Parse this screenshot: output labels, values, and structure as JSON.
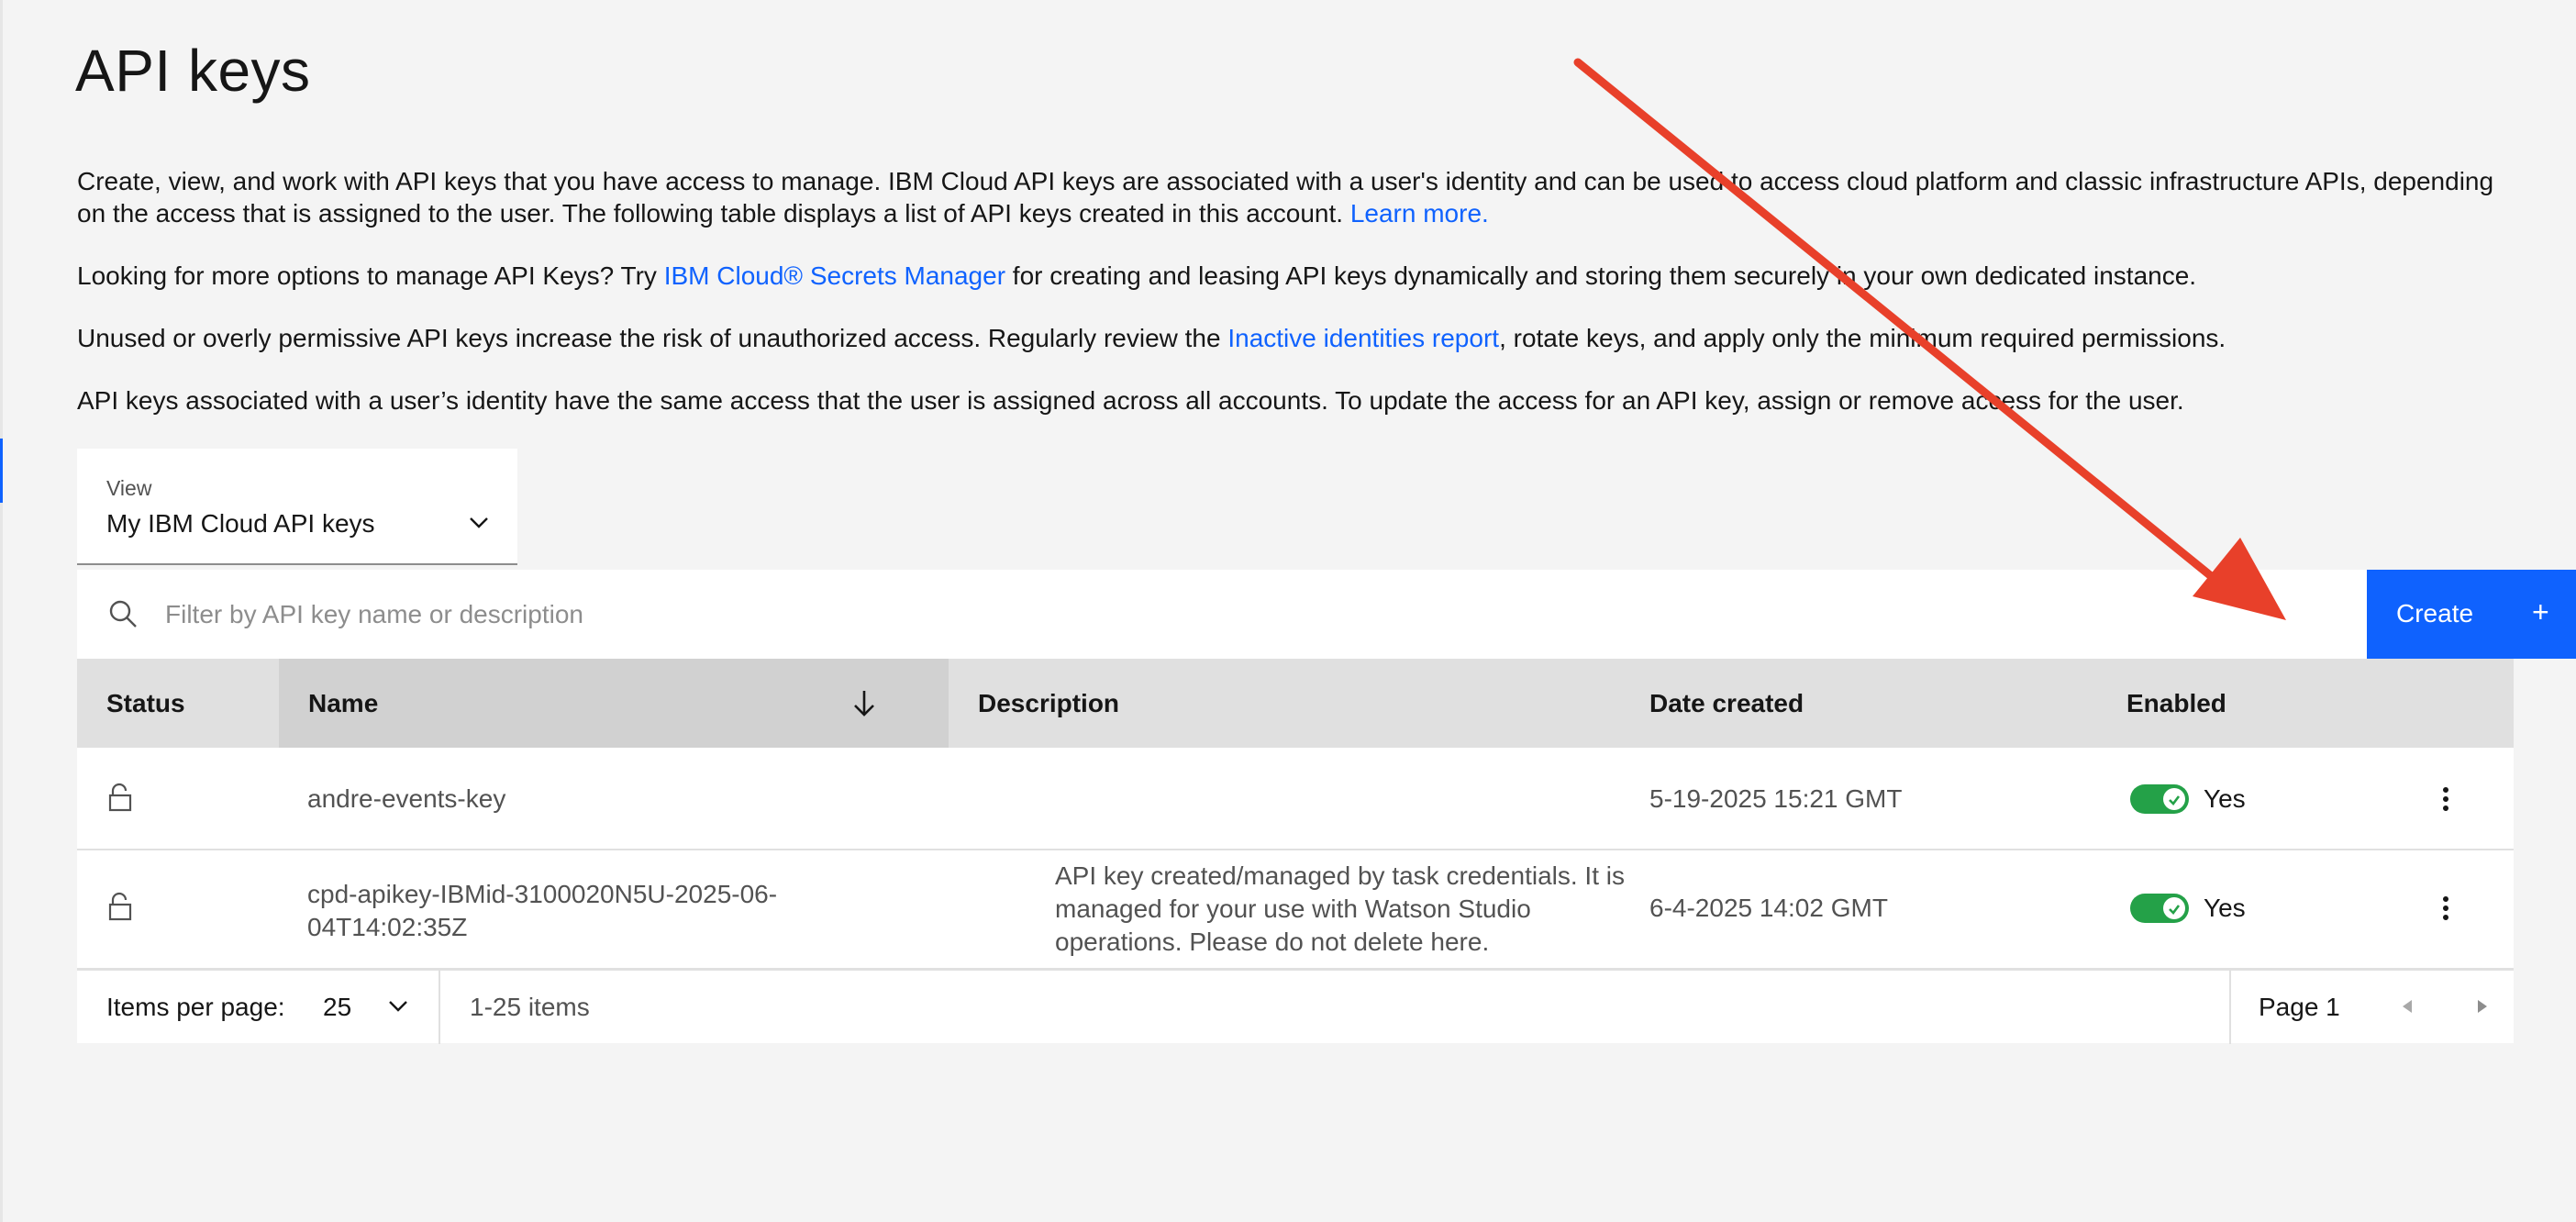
{
  "page": {
    "title": "API keys"
  },
  "intro": {
    "p1_text": "Create, view, and work with API keys that you have access to manage. IBM Cloud API keys are associated with a user's identity and can be used to access cloud platform and classic infrastructure APIs, depending on the access that is assigned to the user. The following table displays a list of API keys created in this account. ",
    "p1_link": "Learn more.",
    "p2_before": "Looking for more options to manage API Keys? Try ",
    "p2_link": "IBM Cloud® Secrets Manager",
    "p2_after": " for creating and leasing API keys dynamically and storing them securely in your own dedicated instance.",
    "p3_before": "Unused or overly permissive API keys increase the risk of unauthorized access. Regularly review the ",
    "p3_link": "Inactive identities report",
    "p3_after": ", rotate keys, and apply only the minimum required permissions.",
    "p4_text": "API keys associated with a user’s identity have the same access that the user is assigned across all accounts. To update the access for an API key, assign or remove access for the user."
  },
  "view_select": {
    "label": "View",
    "value": "My IBM Cloud API keys",
    "icon": "chevron-down-icon"
  },
  "search": {
    "placeholder": "Filter by API key name or description",
    "icon": "search-icon"
  },
  "create_button": {
    "label": "Create",
    "icon_glyph": "+"
  },
  "table": {
    "headers": {
      "status": "Status",
      "name": "Name",
      "description": "Description",
      "date_created": "Date created",
      "enabled": "Enabled"
    },
    "sort": {
      "column": "name",
      "direction": "descending",
      "icon": "arrow-down-icon"
    },
    "rows": [
      {
        "status_icon": "unlocked-icon",
        "name": "andre-events-key",
        "description": "",
        "date_created": "5-19-2025 15:21 GMT",
        "enabled": true,
        "enabled_label": "Yes"
      },
      {
        "status_icon": "unlocked-icon",
        "name_line1": "cpd-apikey-IBMid-3100020N5U-2025-06-",
        "name_line2": "04T14:02:35Z",
        "desc_line1": "API key created/managed by task credentials. It is",
        "desc_line2": "managed for your use with Watson Studio",
        "desc_line3": "operations. Please do not delete here.",
        "date_created": "6-4-2025 14:02 GMT",
        "enabled": true,
        "enabled_label": "Yes"
      }
    ]
  },
  "pagination": {
    "items_per_page_label": "Items per page:",
    "items_per_page_value": "25",
    "item_range": "1-25 items",
    "page_label": "Page 1"
  },
  "colors": {
    "accent": "#0f62fe",
    "toggle_on": "#24a148",
    "annotation_arrow": "#e8402a"
  }
}
